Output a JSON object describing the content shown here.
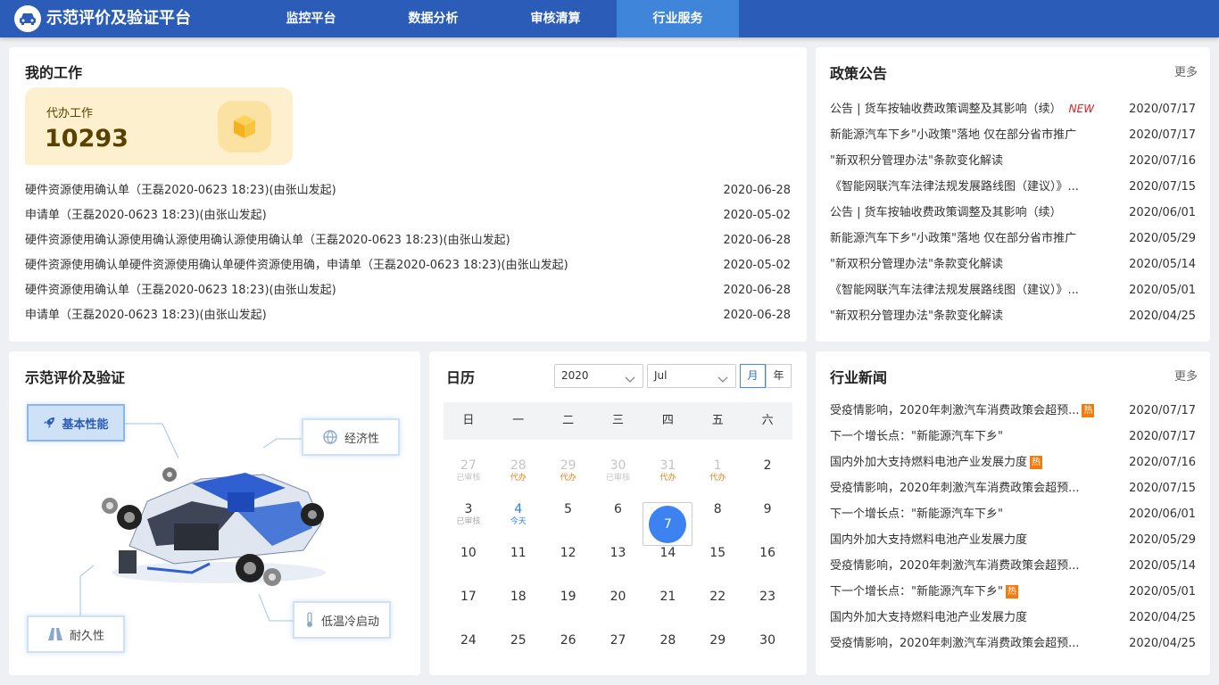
{
  "app": {
    "title": "示范评价及验证平台"
  },
  "nav": [
    "监控平台",
    "数据分析",
    "审核清算",
    "行业服务"
  ],
  "my_work": {
    "title": "我的工作",
    "todo_label": "代办工作",
    "todo_count": "10293",
    "items": [
      {
        "text": "硬件资源使用确认单（王磊2020-0623 18:23)(由张山发起)",
        "date": "2020-06-28"
      },
      {
        "text": "申请单（王磊2020-0623 18:23)(由张山发起)",
        "date": "2020-05-02"
      },
      {
        "text": "硬件资源使用确认源使用确认源使用确认源使用确认单（王磊2020-0623 18:23)(由张山发起)",
        "date": "2020-06-28"
      },
      {
        "text": "硬件资源使用确认单硬件资源使用确认单硬件资源使用确，申请单（王磊2020-0623 18:23)(由张山发起)",
        "date": "2020-05-02"
      },
      {
        "text": "硬件资源使用确认单（王磊2020-0623 18:23)(由张山发起)",
        "date": "2020-06-28"
      },
      {
        "text": "申请单（王磊2020-0623 18:23)(由张山发起)",
        "date": "2020-06-28"
      }
    ]
  },
  "policy": {
    "title": "政策公告",
    "more": "更多",
    "new_tag": "NEW",
    "items": [
      {
        "text": "公告 | 货车按轴收费政策调整及其影响（续）",
        "date": "2020/07/17"
      },
      {
        "text": "新能源汽车下乡\"小政策\"落地 仅在部分省市推广",
        "date": "2020/07/17"
      },
      {
        "text": "\"新双积分管理办法\"条款变化解读",
        "date": "2020/07/16"
      },
      {
        "text": "《智能网联汽车法律法规发展路线图（建议）》...",
        "date": "2020/07/15"
      },
      {
        "text": "公告 | 货车按轴收费政策调整及其影响（续）",
        "date": "2020/06/01"
      },
      {
        "text": "新能源汽车下乡\"小政策\"落地 仅在部分省市推广",
        "date": "2020/05/29"
      },
      {
        "text": "\"新双积分管理办法\"条款变化解读",
        "date": "2020/05/14"
      },
      {
        "text": "《智能网联汽车法律法规发展路线图（建议）》...",
        "date": "2020/05/01"
      },
      {
        "text": "\"新双积分管理办法\"条款变化解读",
        "date": "2020/04/25"
      }
    ]
  },
  "evaluation": {
    "title": "示范评价及验证",
    "tags": [
      "基本性能",
      "经济性",
      "耐久性",
      "低温冷启动"
    ]
  },
  "calendar": {
    "title": "日历",
    "year": "2020",
    "month": "Jul",
    "mode_month": "月",
    "mode_year": "年",
    "weekdays": [
      "日",
      "一",
      "二",
      "三",
      "四",
      "五",
      "六"
    ],
    "days": [
      {
        "n": "27",
        "sub": "已审核"
      },
      {
        "n": "28",
        "sub": "代办"
      },
      {
        "n": "29",
        "sub": "代办"
      },
      {
        "n": "30",
        "sub": "已审核"
      },
      {
        "n": "31",
        "sub": "代办"
      },
      {
        "n": "1",
        "sub": "代办"
      },
      {
        "n": "2",
        "sub": ""
      },
      {
        "n": "3",
        "sub": "已审核"
      },
      {
        "n": "4",
        "sub": "今天"
      },
      {
        "n": "5",
        "sub": ""
      },
      {
        "n": "6",
        "sub": ""
      },
      {
        "n": "7",
        "sub": ""
      },
      {
        "n": "8",
        "sub": ""
      },
      {
        "n": "9",
        "sub": ""
      },
      {
        "n": "10",
        "sub": ""
      },
      {
        "n": "11",
        "sub": ""
      },
      {
        "n": "12",
        "sub": ""
      },
      {
        "n": "13",
        "sub": ""
      },
      {
        "n": "14",
        "sub": ""
      },
      {
        "n": "15",
        "sub": ""
      },
      {
        "n": "16",
        "sub": ""
      },
      {
        "n": "17",
        "sub": ""
      },
      {
        "n": "18",
        "sub": ""
      },
      {
        "n": "19",
        "sub": ""
      },
      {
        "n": "20",
        "sub": ""
      },
      {
        "n": "21",
        "sub": ""
      },
      {
        "n": "22",
        "sub": ""
      },
      {
        "n": "23",
        "sub": ""
      },
      {
        "n": "24",
        "sub": ""
      },
      {
        "n": "25",
        "sub": ""
      },
      {
        "n": "26",
        "sub": ""
      },
      {
        "n": "27",
        "sub": ""
      },
      {
        "n": "28",
        "sub": ""
      },
      {
        "n": "29",
        "sub": ""
      },
      {
        "n": "30",
        "sub": ""
      }
    ]
  },
  "news": {
    "title": "行业新闻",
    "more": "更多",
    "hot_tag": "热",
    "items": [
      {
        "text": "受疫情影响，2020年刺激汽车消费政策会超预...",
        "date": "2020/07/17",
        "hot": true
      },
      {
        "text": "下一个增长点：\"新能源汽车下乡\"",
        "date": "2020/07/17",
        "hot": false
      },
      {
        "text": "国内外加大支持燃料电池产业发展力度",
        "date": "2020/07/16",
        "hot": true
      },
      {
        "text": "受疫情影响，2020年刺激汽车消费政策会超预...",
        "date": "2020/07/15",
        "hot": false
      },
      {
        "text": "下一个增长点：\"新能源汽车下乡\"",
        "date": "2020/06/01",
        "hot": false
      },
      {
        "text": "国内外加大支持燃料电池产业发展力度",
        "date": "2020/05/29",
        "hot": false
      },
      {
        "text": "受疫情影响，2020年刺激汽车消费政策会超预...",
        "date": "2020/05/14",
        "hot": false
      },
      {
        "text": "下一个增长点：\"新能源汽车下乡\"",
        "date": "2020/05/01",
        "hot": true
      },
      {
        "text": "国内外加大支持燃料电池产业发展力度",
        "date": "2020/04/25",
        "hot": false
      },
      {
        "text": "受疫情影响，2020年刺激汽车消费政策会超预...",
        "date": "2020/04/25",
        "hot": false
      }
    ]
  }
}
